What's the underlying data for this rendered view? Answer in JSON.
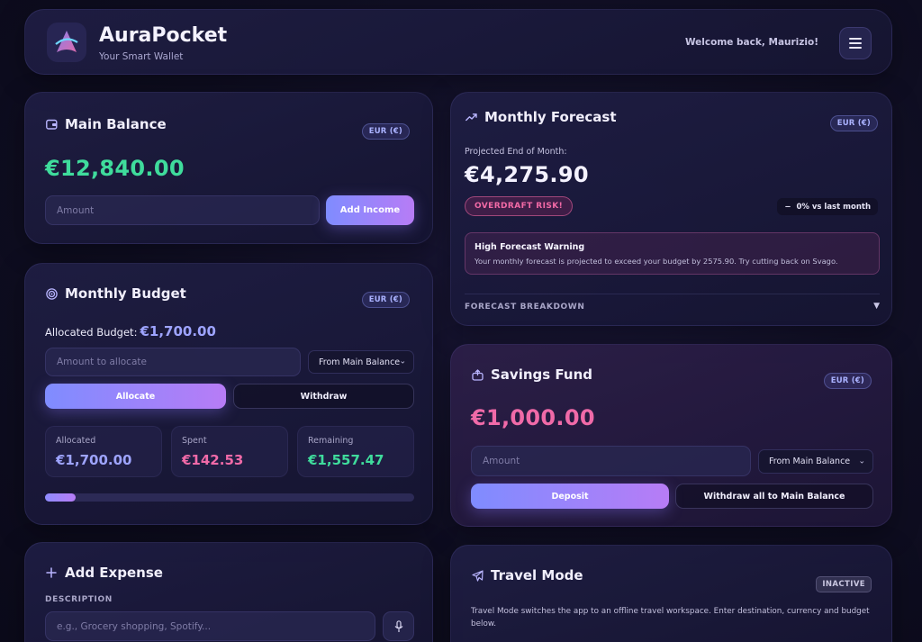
{
  "app": {
    "name": "AuraPocket",
    "tagline": "Your Smart Wallet",
    "welcome": "Welcome back, Maurizio!",
    "menu_icon": "hamburger-menu-icon"
  },
  "colors": {
    "accent_purple": "#8f8cff",
    "accent_pink": "#f06aa8",
    "accent_green": "#3fdc9c",
    "warning_pink": "#f26aa6"
  },
  "main_balance": {
    "title": "Main Balance",
    "icon": "wallet-icon",
    "currency_badge": "EUR (€)",
    "amount": "€12,840.00",
    "input_placeholder": "Amount",
    "button_label": "Add Income"
  },
  "monthly_budget": {
    "title": "Monthly Budget",
    "icon": "target-icon",
    "currency_badge": "EUR (€)",
    "allocated_label": "Allocated Budget:",
    "allocated_value": "€1,700.00",
    "input_placeholder": "Amount to allocate",
    "source_select": "From Main Balance",
    "allocate_label": "Allocate",
    "withdraw_label": "Withdraw",
    "stats": [
      {
        "label": "Allocated",
        "value": "€1,700.00"
      },
      {
        "label": "Spent",
        "value": "€142.53"
      },
      {
        "label": "Remaining",
        "value": "€1,557.47"
      }
    ],
    "progress_fraction": 0.084
  },
  "monthly_forecast": {
    "title": "Monthly Forecast",
    "icon": "trending-up-icon",
    "currency_badge": "EUR (€)",
    "projected_label": "Projected End of Month:",
    "projected_value": "€4,275.90",
    "risk_badge": "OVERDRAFT RISK!",
    "trend_symbol": "−",
    "trend_label": "0% vs last month",
    "warning_title": "High Forecast Warning",
    "warning_text": "Your monthly forecast is projected to exceed your budget by 2575.90. Try cutting back on Svago.",
    "breakdown_label": "FORECAST BREAKDOWN",
    "breakdown_toggle": "▼"
  },
  "savings_fund": {
    "title": "Savings Fund",
    "icon": "piggy-bank-icon",
    "currency_badge": "EUR (€)",
    "amount": "€1,000.00",
    "input_placeholder": "Amount",
    "source_select": "From Main Balance",
    "deposit_label": "Deposit",
    "withdraw_all_label": "Withdraw all to Main Balance"
  },
  "add_expense": {
    "title": "Add Expense",
    "icon": "plus-icon",
    "description_label": "DESCRIPTION",
    "description_placeholder": "e.g., Grocery shopping, Spotify...",
    "mic_icon": "microphone-icon"
  },
  "travel_mode": {
    "title": "Travel Mode",
    "icon": "airplane-icon",
    "status_badge": "INACTIVE",
    "description": "Travel Mode switches the app to an offline travel workspace. Enter destination, currency and budget below."
  }
}
